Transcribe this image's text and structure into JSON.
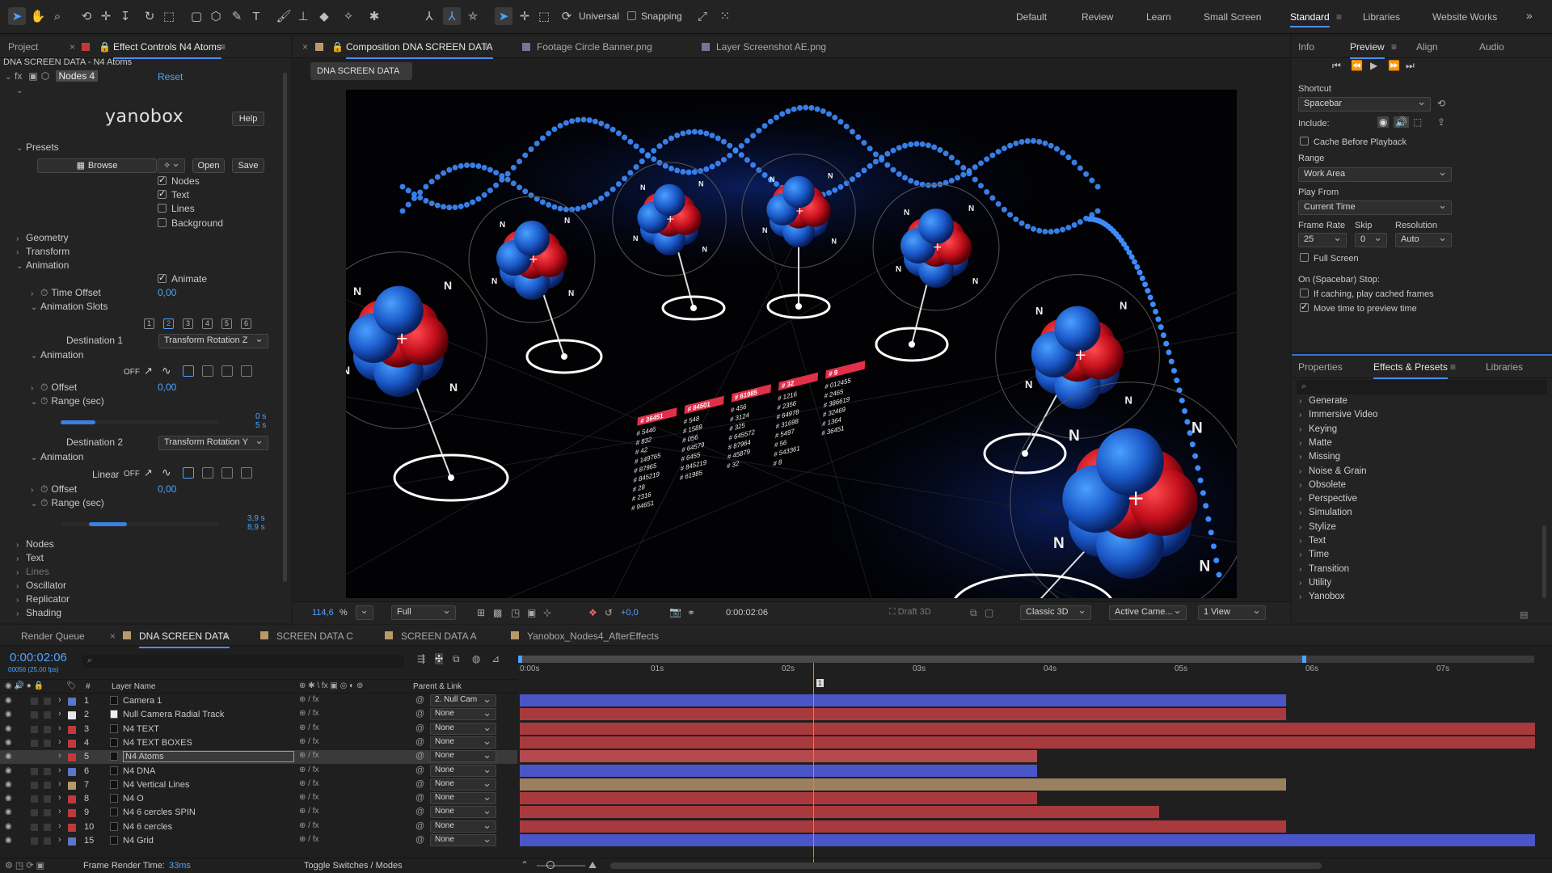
{
  "toolbar": {
    "toggles": {
      "universal": "Universal",
      "snapping": "Snapping"
    },
    "workspaces": [
      "Default",
      "Review",
      "Learn",
      "Small Screen",
      "Standard",
      "Libraries",
      "Website Works"
    ],
    "active_workspace": "Standard",
    "overflow": "»"
  },
  "left_panel": {
    "tabs": {
      "project": "Project",
      "effect_controls": "Effect Controls N4 Atoms"
    },
    "breadcrumb": "DNA SCREEN DATA - N4 Atoms",
    "effect_name": "Nodes 4",
    "reset": "Reset",
    "brand": "yanobox",
    "help": "Help",
    "presets_label": "Presets",
    "browse": "Browse",
    "open": "Open",
    "save": "Save",
    "checkboxes": [
      {
        "label": "Nodes",
        "checked": true
      },
      {
        "label": "Text",
        "checked": true
      },
      {
        "label": "Lines",
        "checked": false
      },
      {
        "label": "Background",
        "checked": false
      }
    ],
    "geometry": "Geometry",
    "transform": "Transform",
    "animation": "Animation",
    "animate": "Animate",
    "time_offset": {
      "label": "Time Offset",
      "value": "0,00"
    },
    "animation_slots": "Animation Slots",
    "slots": [
      "1",
      "2",
      "3",
      "4",
      "5",
      "6"
    ],
    "active_slot": 2,
    "dest1": {
      "label": "Destination 1",
      "value": "Transform Rotation Z"
    },
    "dest2": {
      "label": "Destination 2",
      "value": "Transform Rotation Y"
    },
    "anim_sub": "Animation",
    "off": "OFF",
    "linear": "Linear",
    "offset": {
      "label": "Offset",
      "value": "0,00"
    },
    "range": {
      "label": "Range (sec)"
    },
    "range1": {
      "start": "0 s",
      "end": "5 s",
      "fill_start": 0.0,
      "fill_end": 0.22
    },
    "range2": {
      "start": "3,9 s",
      "end": "8,9 s",
      "fill_start": 0.18,
      "fill_end": 0.42
    },
    "groups": [
      "Nodes",
      "Text",
      "Lines",
      "Oscillator",
      "Replicator",
      "Shading"
    ]
  },
  "composition": {
    "tabs": {
      "comp": "Composition DNA SCREEN DATA",
      "footage": "Footage Circle Banner.png",
      "layer": "Layer Screenshot AE.png"
    },
    "name_chip": "DNA SCREEN DATA",
    "zoom": "114,6",
    "zoom_unit": "%",
    "resolution": "Full",
    "exposure": "+0,0",
    "timecode": "0:00:02:06",
    "draft": "Draft 3D",
    "renderer": "Classic 3D",
    "camera": "Active Came...",
    "views": "1 View",
    "atom_label": "N",
    "data_tags": [
      "# 36451",
      "# 84501",
      "# 61985",
      "# 32",
      "# 9"
    ],
    "data_cols": [
      [
        "# 5446",
        "# 832",
        "# 42",
        "# 149765",
        "# 87965",
        "# 845219",
        "# 28",
        "# 2316",
        "# 94651"
      ],
      [
        "# 548",
        "# 1589",
        "# 056",
        "# 64579",
        "# 6455",
        "# 845219",
        "# 61985"
      ],
      [
        "# 456",
        "# 3124",
        "# 325",
        "# 645572",
        "# 87964",
        "# 45879",
        "# 32"
      ],
      [
        "# 1216",
        "# 2356",
        "# 64978",
        "# 31698",
        "# 5497",
        "# 56",
        "# 543361",
        "# 8"
      ],
      [
        "# 012455",
        "# 2465",
        "# 386619",
        "# 32469",
        "# 1364",
        "# 36451"
      ]
    ]
  },
  "right_panel": {
    "tabs": [
      "Info",
      "Preview",
      "Align",
      "Audio"
    ],
    "active_tab": "Preview",
    "shortcut_label": "Shortcut",
    "shortcut": "Spacebar",
    "include": "Include:",
    "cache": "Cache Before Playback",
    "range_label": "Range",
    "range": "Work Area",
    "play_from_label": "Play From",
    "play_from": "Current Time",
    "frame_rate_label": "Frame Rate",
    "frame_rate": "25",
    "skip_label": "Skip",
    "skip": "0",
    "resolution_label": "Resolution",
    "resolution": "Auto",
    "full_screen": "Full Screen",
    "on_stop": "On (Spacebar) Stop:",
    "if_caching": "If caching, play cached frames",
    "move_time": "Move time to preview time"
  },
  "effects_panel": {
    "tabs": [
      "Properties",
      "Effects & Presets",
      "Libraries"
    ],
    "active_tab": "Effects & Presets",
    "items": [
      "Generate",
      "Immersive Video",
      "Keying",
      "Matte",
      "Missing",
      "Noise & Grain",
      "Obsolete",
      "Perspective",
      "Simulation",
      "Stylize",
      "Text",
      "Time",
      "Transition",
      "Utility",
      "Yanobox"
    ]
  },
  "timeline": {
    "tabs": [
      "Render Queue",
      "DNA SCREEN DATA",
      "SCREEN DATA C",
      "SCREEN DATA A",
      "Yanobox_Nodes4_AfterEffects"
    ],
    "active_tab": "DNA SCREEN DATA",
    "timecode": "0:00:02:06",
    "frame_info": "00056 (25.00 fps)",
    "columns": {
      "num": "#",
      "layer_name": "Layer Name",
      "parent": "Parent & Link"
    },
    "ruler": [
      "0:00s",
      "01s",
      "02s",
      "03s",
      "04s",
      "05s",
      "06s",
      "07s"
    ],
    "marker": "1",
    "playhead_sec": 2.24,
    "layers": [
      {
        "num": "1",
        "name": "Camera 1",
        "parent": "2. Null Cam",
        "color": "#5a76c9",
        "bar": "#4a55c8",
        "start": 0,
        "end": 5.85
      },
      {
        "num": "2",
        "name": "Null Camera Radial Track",
        "parent": "None",
        "color": "#e6e6e6",
        "bar": "#a83a3e",
        "start": 0,
        "end": 5.85
      },
      {
        "num": "3",
        "name": "N4  TEXT",
        "parent": "None",
        "color": "#c2393c",
        "bar": "#a83a3e",
        "start": 0,
        "end": 7.75
      },
      {
        "num": "4",
        "name": "N4 TEXT BOXES",
        "parent": "None",
        "color": "#c2393c",
        "bar": "#a83a3e",
        "start": 0,
        "end": 7.75
      },
      {
        "num": "5",
        "name": "N4 Atoms",
        "parent": "None",
        "color": "#c2393c",
        "bar": "#b44a4e",
        "start": 0,
        "end": 3.95,
        "selected": true
      },
      {
        "num": "6",
        "name": "N4 DNA",
        "parent": "None",
        "color": "#5a76c9",
        "bar": "#4a55c8",
        "start": 0,
        "end": 3.95
      },
      {
        "num": "7",
        "name": "N4 Vertical Lines",
        "parent": "None",
        "color": "#b89a6a",
        "bar": "#9a8060",
        "start": 0,
        "end": 5.85
      },
      {
        "num": "8",
        "name": "N4 O",
        "parent": "None",
        "color": "#c2393c",
        "bar": "#a83a3e",
        "start": 0,
        "end": 3.95
      },
      {
        "num": "9",
        "name": "N4 6 cercles SPIN",
        "parent": "None",
        "color": "#c2393c",
        "bar": "#a83a3e",
        "start": 0,
        "end": 4.88
      },
      {
        "num": "10",
        "name": "N4 6 cercles",
        "parent": "None",
        "color": "#c2393c",
        "bar": "#a83a3e",
        "start": 0,
        "end": 5.85
      },
      {
        "num": "15",
        "name": "N4 Grid",
        "parent": "None",
        "color": "#5a76c9",
        "bar": "#4a55c8",
        "start": 0,
        "end": 7.75
      }
    ],
    "frame_render_label": "Frame Render Time:",
    "frame_render_value": "33ms",
    "toggle": "Toggle Switches / Modes"
  }
}
